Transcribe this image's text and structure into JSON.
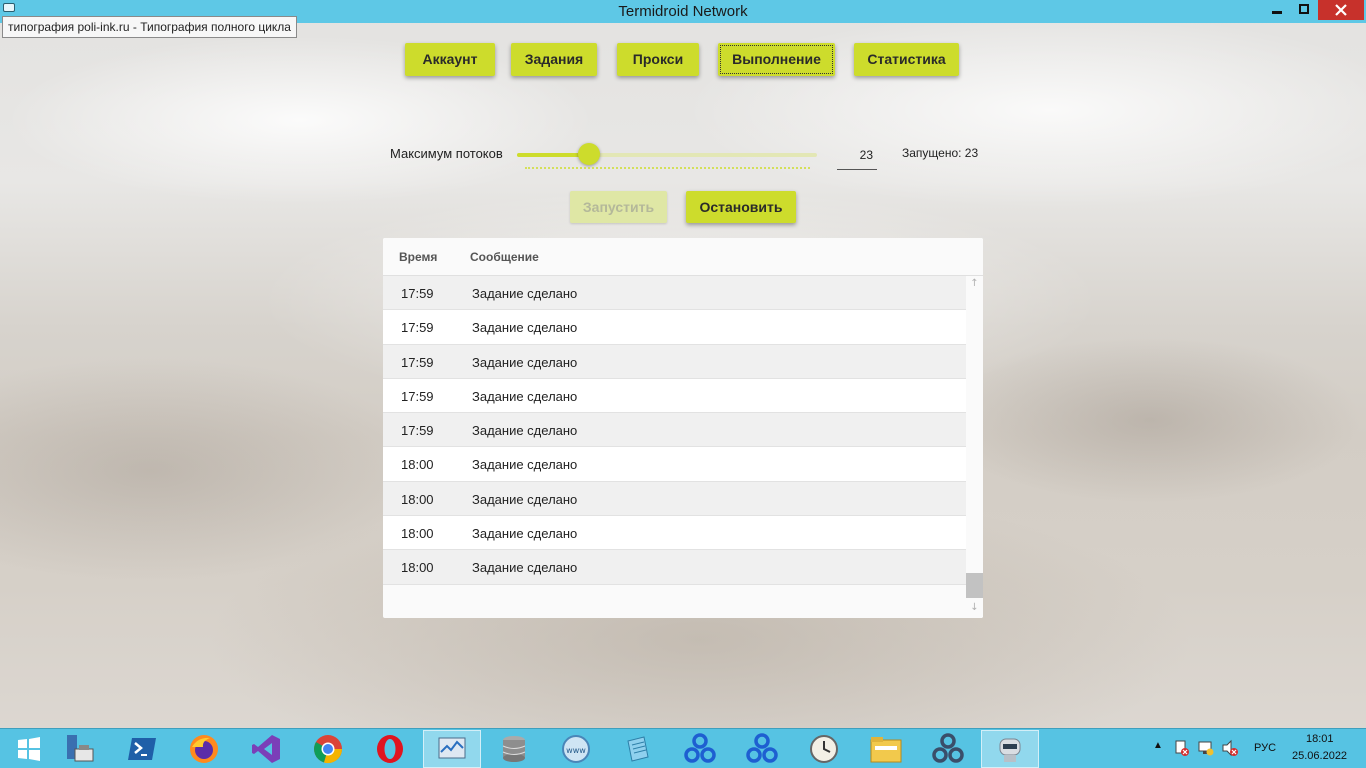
{
  "window": {
    "title": "Termidroid Network",
    "tooltip": "типография poli-ink.ru - Типография полного цикла"
  },
  "nav": [
    {
      "label": "Аккаунт",
      "active": false
    },
    {
      "label": "Задания",
      "active": false
    },
    {
      "label": "Прокси",
      "active": false
    },
    {
      "label": "Выполнение",
      "active": true
    },
    {
      "label": "Статистика",
      "active": false
    }
  ],
  "threads": {
    "label": "Максимум потоков",
    "value": "23",
    "slider_fraction": 0.24,
    "running": "Запущено: 23"
  },
  "actions": {
    "start_label": "Запустить",
    "start_enabled": false,
    "stop_label": "Остановить"
  },
  "log": {
    "columns": [
      "Время",
      "Сообщение"
    ],
    "rows": [
      {
        "time": "17:59",
        "message": "Задание сделано"
      },
      {
        "time": "17:59",
        "message": "Задание сделано"
      },
      {
        "time": "17:59",
        "message": "Задание сделано"
      },
      {
        "time": "17:59",
        "message": "Задание сделано"
      },
      {
        "time": "17:59",
        "message": "Задание сделано"
      },
      {
        "time": "18:00",
        "message": "Задание сделано"
      },
      {
        "time": "18:00",
        "message": "Задание сделано"
      },
      {
        "time": "18:00",
        "message": "Задание сделано"
      },
      {
        "time": "18:00",
        "message": "Задание сделано"
      }
    ]
  },
  "taskbar": {
    "apps": [
      "windows-start-icon",
      "server-manager-icon",
      "powershell-icon",
      "firefox-icon",
      "visual-studio-icon",
      "chrome-icon",
      "opera-icon",
      "performance-monitor-icon",
      "database-icon",
      "www-icon",
      "notepad-icon",
      "network-app-icon",
      "network-app-icon",
      "clock-app-icon",
      "file-explorer-icon",
      "network-app-icon",
      "robot-app-icon"
    ],
    "language": "РУС",
    "time": "18:01",
    "date": "25.06.2022"
  },
  "colors": {
    "accent": "#cddc2c",
    "titlebar": "#5ec8e6",
    "taskbar": "#56c3e3",
    "close": "#c7312b"
  }
}
